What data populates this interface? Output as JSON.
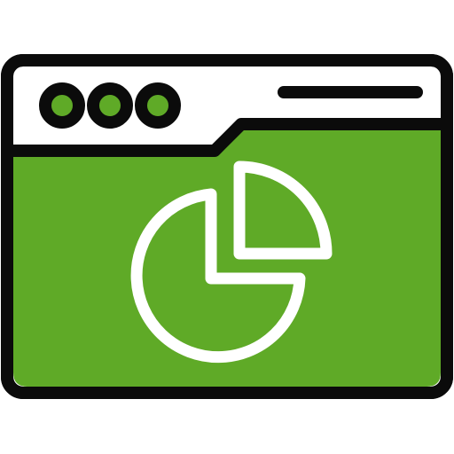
{
  "icon": {
    "name": "browser-window-pie-chart-icon",
    "colors": {
      "outline": "#0b0b0b",
      "titlebar": "#ffffff",
      "content": "#5faa27",
      "window_dot": "#5faa27",
      "chart_stroke": "#ffffff"
    },
    "window_controls": [
      "window-dot",
      "window-dot",
      "window-dot"
    ],
    "address_bar": "address-bar-line",
    "chart_icon": "pie-chart-icon"
  }
}
